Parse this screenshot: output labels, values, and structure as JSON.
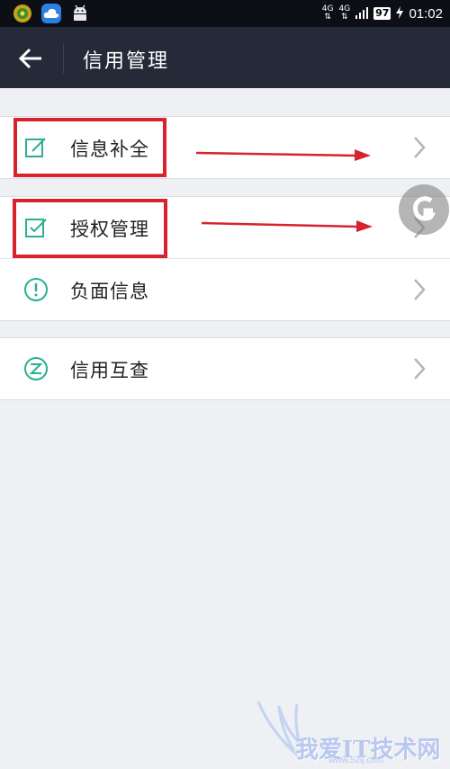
{
  "statusbar": {
    "network_1": "4G",
    "network_2": "4G",
    "battery": "97",
    "time": "01:02"
  },
  "header": {
    "title": "信用管理"
  },
  "menu": {
    "group1": [
      {
        "label": "信息补全",
        "icon": "edit-icon"
      }
    ],
    "group2": [
      {
        "label": "授权管理",
        "icon": "checkbox-icon"
      },
      {
        "label": "负面信息",
        "icon": "alert-circle-icon"
      }
    ],
    "group3": [
      {
        "label": "信用互查",
        "icon": "mutual-check-icon"
      }
    ]
  },
  "colors": {
    "accent": "#2bb08f",
    "header_bg": "#242a38",
    "annotation": "#d8232e"
  },
  "watermark": {
    "text": "我爱IT技术网",
    "url": "www.52ij.com"
  }
}
